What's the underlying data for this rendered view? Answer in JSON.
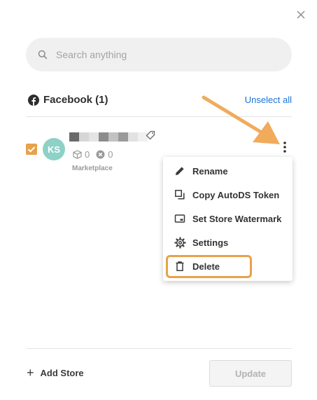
{
  "search": {
    "placeholder": "Search anything",
    "icon": "search-icon"
  },
  "section": {
    "title": "Facebook (1)",
    "icon": "facebook-icon",
    "unselect_label": "Unselect all"
  },
  "store": {
    "initials": "KS",
    "selected": true,
    "products_count": "0",
    "errors_count": "0",
    "type": "Marketplace",
    "avatar_color": "#8ed1c6"
  },
  "menu": {
    "items": [
      {
        "label": "Rename",
        "icon": "pencil-icon"
      },
      {
        "label": "Copy AutoDS Token",
        "icon": "copy-icon"
      },
      {
        "label": "Set Store Watermark",
        "icon": "watermark-icon"
      },
      {
        "label": "Settings",
        "icon": "gear-icon"
      },
      {
        "label": "Delete",
        "icon": "trash-icon"
      }
    ]
  },
  "footer": {
    "add_store_label": "Add Store",
    "update_label": "Update"
  },
  "colors": {
    "accent": "#e8a24a",
    "link": "#1a73d9",
    "checkbox": "#e8a24a"
  }
}
